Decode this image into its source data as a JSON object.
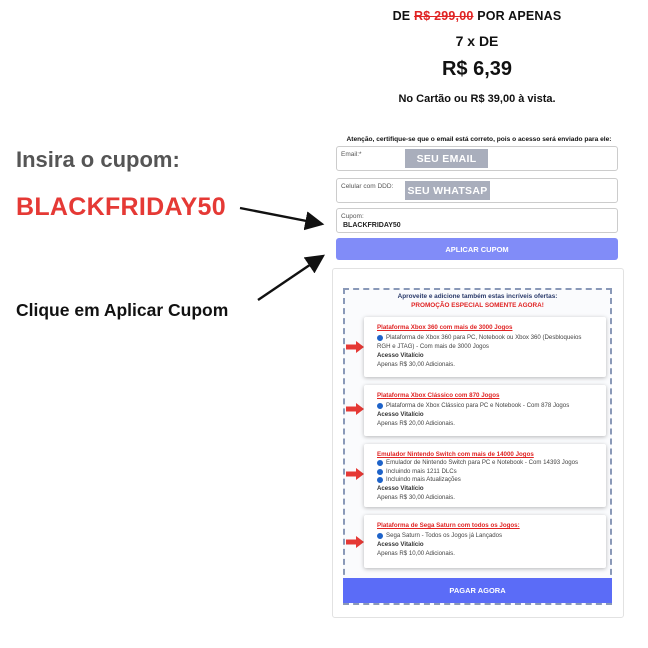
{
  "price": {
    "from_label": "DE",
    "old_price": "R$ 299,00",
    "for_label": "POR APENAS",
    "installments": "7 x DE",
    "installment_value": "R$ 6,39",
    "card_or_cash": "No Cartão ou R$ 39,00 à vista."
  },
  "instructions": {
    "insert_coupon": "Insira o cupom:",
    "coupon_code": "BLACKFRIDAY50",
    "click_apply": "Clique em Aplicar Cupom"
  },
  "form": {
    "notice": "Atenção, certifique-se que o email está correto, pois o acesso será enviado para ele:",
    "email_label": "Email:*",
    "email_badge": "SEU EMAIL",
    "phone_label": "Celular com DDD:",
    "phone_badge": "SEU WHATSAP",
    "coupon_label": "Cupom:",
    "coupon_value": "BLACKFRIDAY50",
    "apply_button": "APLICAR CUPOM"
  },
  "offers": {
    "title": "Aproveite e adicione também estas incríveis ofertas:",
    "subtitle": "PROMOÇÃO ESPECIAL SOMENTE AGORA!",
    "items": [
      {
        "title": "Plataforma Xbox 360 com mais de 3000 Jogos",
        "bullets": [
          "Plataforma de Xbox 360 para PC, Notebook ou Xbox 360 (Desbloqueios",
          "RGH e JTAG) - Com mais de 3000 Jogos"
        ],
        "access": "Acesso Vitalício",
        "price": "Apenas R$ 30,00 Adicionais."
      },
      {
        "title": "Plataforma Xbox Clássico com 870 Jogos",
        "bullets": [
          "Plataforma de Xbox Clássico para PC e Notebook - Com 878 Jogos"
        ],
        "access": "Acesso Vitalício",
        "price": "Apenas R$ 20,00 Adicionais."
      },
      {
        "title": "Emulador Nintendo Switch com mais de 14000 Jogos",
        "bullets": [
          "Emulador de Nintendo Switch para PC e Notebook - Com 14393 Jogos",
          "Incluindo mais 1211 DLCs",
          "Incluindo mais Atualizações"
        ],
        "access": "Acesso Vitalício",
        "price": "Apenas R$ 30,00 Adicionais."
      },
      {
        "title": "Plataforma de Sega Saturn com todos os Jogos:",
        "bullets": [
          "Sega Saturn - Todos os Jogos já Lançados"
        ],
        "access": "Acesso Vitalício",
        "price": "Apenas R$ 10,00 Adicionais."
      }
    ],
    "pay_button": "PAGAR AGORA"
  },
  "icons": {
    "offer_arrow": "right-arrow-icon",
    "bullet": "blue-dot-icon"
  },
  "colors": {
    "accent_red": "#e53935",
    "apply_button": "#818cf8",
    "pay_button": "#5b6cf7",
    "badge_gray": "#a9aebc"
  }
}
